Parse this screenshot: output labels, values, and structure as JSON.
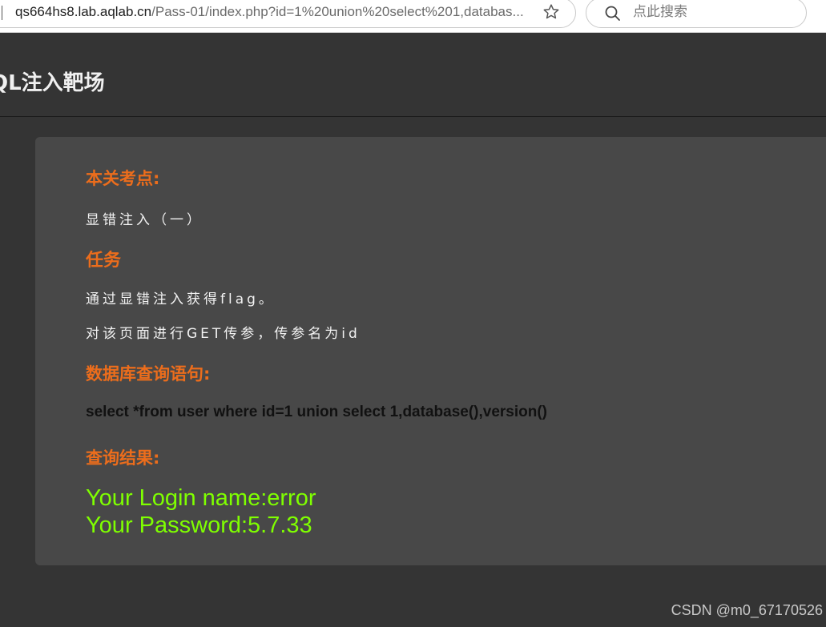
{
  "browser": {
    "url_host": "qs664hs8.lab.aqlab.cn",
    "url_path": "/Pass-01/index.php?id=1%20union%20select%201,databas...",
    "bookmark_icon": "star-icon",
    "search_placeholder": "点此搜索",
    "search_icon": "search-icon"
  },
  "page": {
    "title": "QL注入靶场"
  },
  "panel": {
    "checkpoint_heading": "本关考点:",
    "checkpoint_text": "显错注入（一）",
    "task_heading": "任务",
    "task_line1": "通过显错注入获得flag。",
    "task_line2": "对该页面进行GET传参，传参名为id",
    "query_heading": "数据库查询语句:",
    "query_sql": "select *from user where id=1 union select 1,database(),version()",
    "result_heading": "查询结果:",
    "result_line1": "Your Login name:error",
    "result_line2": "Your Password:5.7.33"
  },
  "watermark": "CSDN @m0_67170526",
  "colors": {
    "background": "#343434",
    "panel": "#484848",
    "heading_accent": "#ec6d1c",
    "result_text": "#7fff00"
  }
}
